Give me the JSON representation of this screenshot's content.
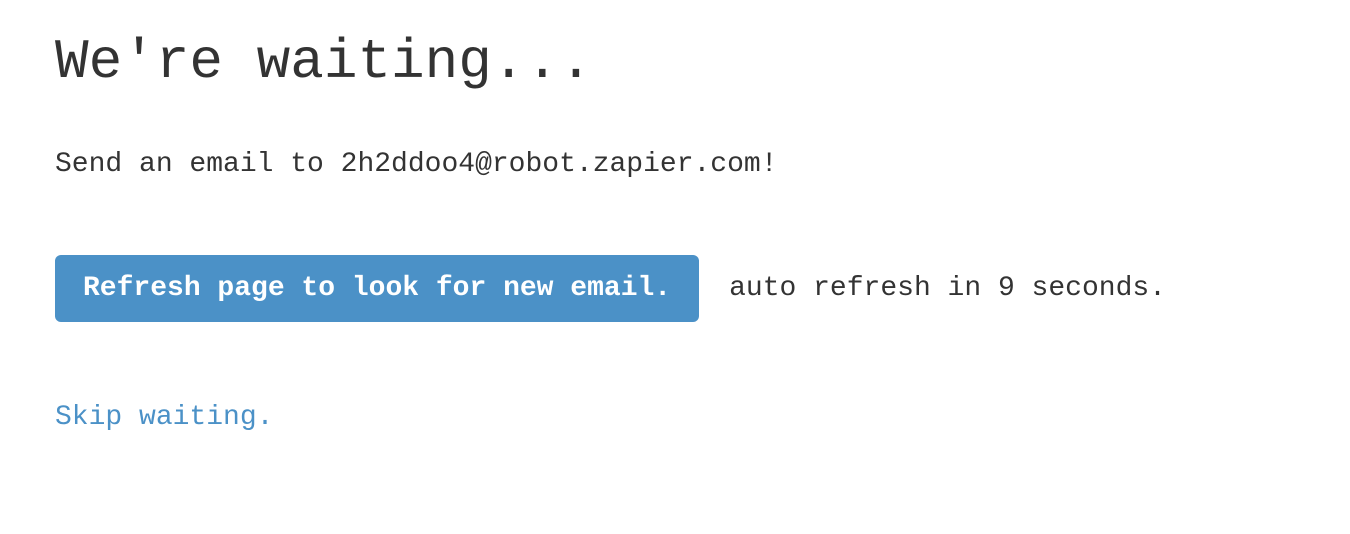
{
  "heading": "We're waiting...",
  "instruction": "Send an email to 2h2ddoo4@robot.zapier.com!",
  "refresh_button_label": "Refresh page to look for new email.",
  "auto_refresh_text": "auto refresh in 9 seconds.",
  "skip_link_label": "Skip waiting."
}
